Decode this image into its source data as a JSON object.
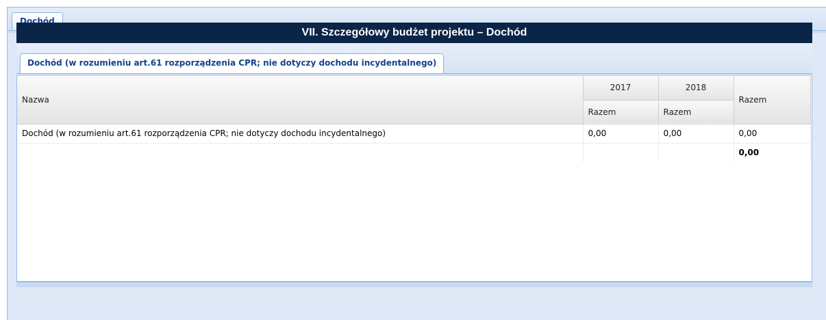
{
  "top_tab": {
    "label": "Dochód"
  },
  "section": {
    "title": "VII. Szczegółowy budżet projektu – Dochód"
  },
  "inner_tab": {
    "label": "Dochód (w rozumieniu art.61 rozporządzenia CPR; nie dotyczy dochodu incydentalnego)"
  },
  "grid": {
    "headers": {
      "name": "Nazwa",
      "years": [
        "2017",
        "2018"
      ],
      "year_sub": [
        "Razem",
        "Razem"
      ],
      "total": "Razem"
    },
    "rows": [
      {
        "name": "Dochód (w rozumieniu art.61 rozporządzenia CPR; nie dotyczy dochodu incydentalnego)",
        "values": [
          "0,00",
          "0,00"
        ],
        "total": "0,00"
      }
    ],
    "summary": {
      "total": "0,00"
    }
  },
  "colors": {
    "header_bg": "#0b2548",
    "tab_text": "#15428b",
    "panel_bg": "#dfe8f6",
    "border": "#99bbe8"
  }
}
